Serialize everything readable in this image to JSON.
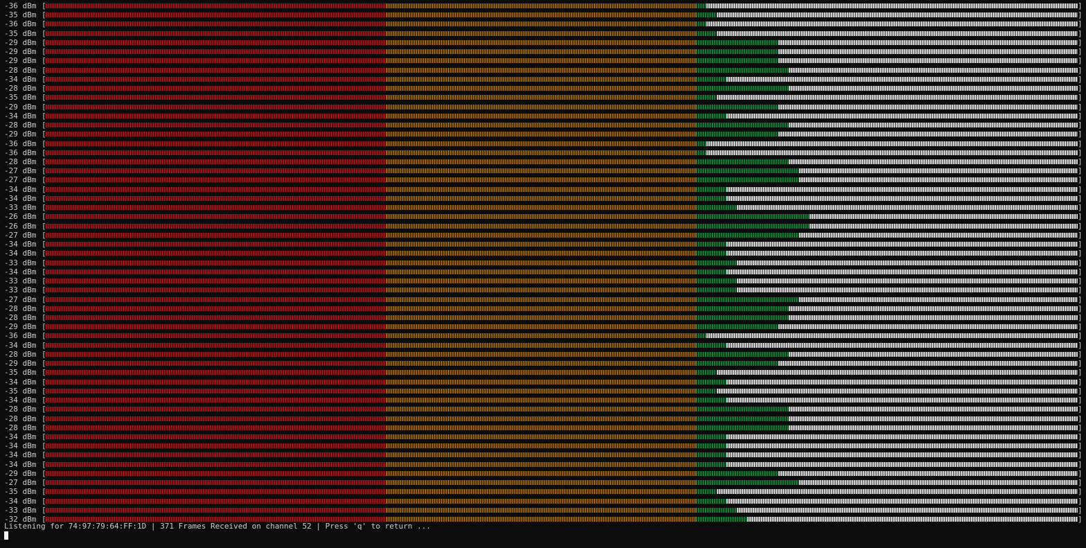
{
  "terminal": {
    "unit": "dBm",
    "bracket_open": "[",
    "bracket_close": "]",
    "colors": {
      "background": "#0c0c0c",
      "text": "#cccccc",
      "red": "#c01c28",
      "orange": "#c4801c",
      "green": "#26a269",
      "white": "#f2f2f2"
    },
    "scale": {
      "min_dbm": -100,
      "max_dbm": 0
    },
    "readings": [
      -36,
      -35,
      -36,
      -35,
      -29,
      -29,
      -29,
      -28,
      -34,
      -28,
      -35,
      -29,
      -34,
      -28,
      -29,
      -36,
      -36,
      -28,
      -27,
      -27,
      -34,
      -34,
      -33,
      -26,
      -26,
      -27,
      -34,
      -34,
      -33,
      -34,
      -33,
      -33,
      -27,
      -28,
      -28,
      -29,
      -36,
      -34,
      -28,
      -29,
      -35,
      -34,
      -35,
      -34,
      -28,
      -28,
      -28,
      -34,
      -34,
      -34,
      -34,
      -29,
      -27,
      -35,
      -34,
      -33,
      -32
    ]
  },
  "status": {
    "text": "Listening for 74:97:79:64:FF:1D | 371 Frames Received on channel 52 | Press 'q' to return ..."
  }
}
